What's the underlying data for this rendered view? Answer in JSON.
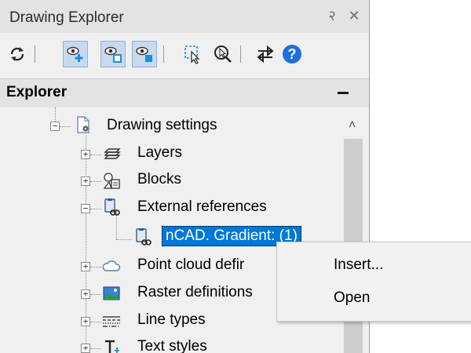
{
  "panel": {
    "title": "Drawing Explorer",
    "pin_glyph": "२",
    "close_glyph": "✕"
  },
  "toolbar": {
    "buttons": [
      {
        "icon": "refresh-icon"
      },
      {
        "icon": "show-all-icon",
        "active": true
      },
      {
        "icon": "show-selected-icon",
        "active": true
      },
      {
        "icon": "show-filtered-icon",
        "active": true
      },
      {
        "icon": "select-objects-icon"
      },
      {
        "icon": "find-zoom-icon"
      },
      {
        "icon": "swap-icon"
      },
      {
        "icon": "help-icon"
      }
    ],
    "help_glyph": "?"
  },
  "explorer": {
    "header": "Explorer",
    "scroll_up_glyph": "˄",
    "tree": [
      {
        "label": "Drawing settings",
        "icon": "drawing-settings-icon",
        "expanded": true,
        "depth": 0
      },
      {
        "label": "Layers",
        "icon": "layers-icon",
        "expanded": false,
        "depth": 1
      },
      {
        "label": "Blocks",
        "icon": "blocks-icon",
        "expanded": false,
        "depth": 1
      },
      {
        "label": "External references",
        "icon": "external-references-icon",
        "expanded": true,
        "depth": 1
      },
      {
        "label": "nCAD. Gradient: (1)",
        "icon": "external-reference-icon",
        "selected": true,
        "depth": 2
      },
      {
        "label": "Point cloud defir",
        "icon": "point-cloud-icon",
        "expanded": false,
        "depth": 1
      },
      {
        "label": "Raster definitions",
        "icon": "raster-icon",
        "expanded": false,
        "depth": 1
      },
      {
        "label": "Line types",
        "icon": "line-types-icon",
        "expanded": false,
        "depth": 1
      },
      {
        "label": "Text styles",
        "icon": "text-styles-icon",
        "expanded": false,
        "depth": 1
      }
    ],
    "expand_glyph": "+",
    "collapse_glyph": "−"
  },
  "context_menu": {
    "items": [
      "Insert...",
      "Open"
    ]
  },
  "colors": {
    "selection": "#0078d7",
    "active_button": "#c9d9ec",
    "help_blue": "#1e6fd9"
  }
}
